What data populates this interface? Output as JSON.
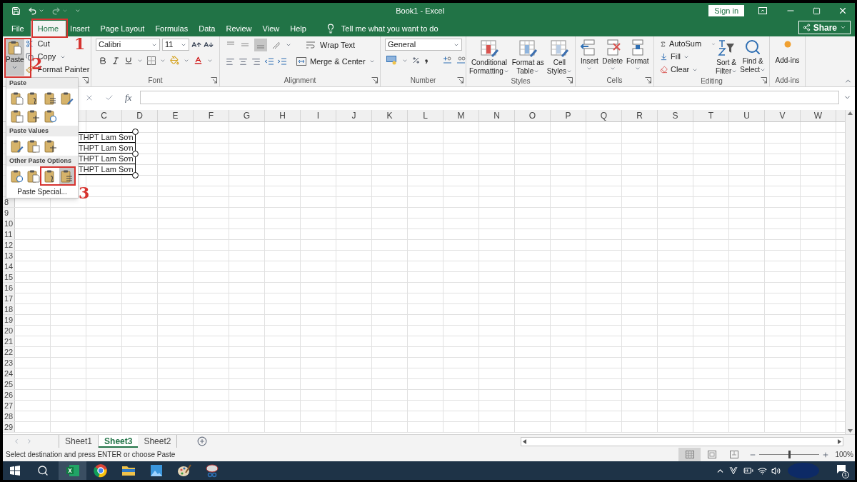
{
  "title": "Book1  -  Excel",
  "sign_in": "Sign in",
  "share": "Share",
  "tabs": [
    {
      "label": "File",
      "selected": false
    },
    {
      "label": "Home",
      "selected": true
    },
    {
      "label": "Insert",
      "selected": false
    },
    {
      "label": "Page Layout",
      "selected": false
    },
    {
      "label": "Formulas",
      "selected": false
    },
    {
      "label": "Data",
      "selected": false
    },
    {
      "label": "Review",
      "selected": false
    },
    {
      "label": "View",
      "selected": false
    },
    {
      "label": "Help",
      "selected": false
    }
  ],
  "tell_me": "Tell me what you want to do",
  "clipboard": {
    "paste": "Paste",
    "cut": "Cut",
    "copy": "Copy",
    "format_painter": "Format Painter"
  },
  "font": {
    "name": "Calibri",
    "size": "11",
    "label": "Font"
  },
  "alignment": {
    "wrap_text": "Wrap Text",
    "merge": "Merge & Center",
    "label": "Alignment"
  },
  "number": {
    "format": "General",
    "label": "Number"
  },
  "styles": {
    "buttons": [
      {
        "lines": [
          "Conditional",
          "Formatting"
        ]
      },
      {
        "lines": [
          "Format as",
          "Table"
        ]
      },
      {
        "lines": [
          "Cell",
          "Styles"
        ]
      }
    ],
    "label": "Styles"
  },
  "cells": {
    "buttons": [
      "Insert",
      "Delete",
      "Format"
    ],
    "label": "Cells"
  },
  "editing": {
    "autosum": "AutoSum",
    "fill": "Fill",
    "clear": "Clear",
    "buttons": [
      {
        "lines": [
          "Sort &",
          "Filter"
        ]
      },
      {
        "lines": [
          "Find &",
          "Select"
        ]
      }
    ],
    "label": "Editing"
  },
  "addins": {
    "button": "Add-ins",
    "label": "Add-ins"
  },
  "formula_bar": {
    "fx": "fx"
  },
  "columns": [
    "C",
    "D",
    "E",
    "F",
    "G",
    "H",
    "I",
    "J",
    "K",
    "L",
    "M",
    "N",
    "O",
    "P",
    "Q",
    "R",
    "S",
    "T",
    "U",
    "V",
    "W"
  ],
  "rows": [
    "8",
    "9",
    "10",
    "11",
    "12",
    "13",
    "14",
    "15",
    "16",
    "17",
    "18",
    "19",
    "20",
    "21",
    "22",
    "23",
    "24",
    "25",
    "26",
    "27",
    "28",
    "29"
  ],
  "linked_picture": {
    "lines": [
      "THPT Lam Sơn",
      "THPT Lam Sơn",
      "THPT Lam Sơn",
      "THPT Lam Sơn"
    ]
  },
  "paste_menu": {
    "sections": [
      {
        "title": "Paste",
        "items": [
          {
            "selected": false
          },
          {
            "selected": false
          },
          {
            "selected": false
          },
          {
            "selected": false
          },
          {
            "selected": false
          },
          {
            "selected": false
          },
          {
            "selected": false
          }
        ]
      },
      {
        "title": "Paste Values",
        "items": [
          {
            "selected": false
          },
          {
            "selected": false
          },
          {
            "selected": false
          }
        ]
      },
      {
        "title": "Other Paste Options",
        "items": [
          {
            "selected": false
          },
          {
            "selected": false
          },
          {
            "selected": false
          },
          {
            "selected": true
          }
        ]
      }
    ],
    "paste_special": "Paste Special..."
  },
  "sheets": [
    {
      "label": "Sheet1",
      "selected": false
    },
    {
      "label": "Sheet3",
      "selected": true
    },
    {
      "label": "Sheet2",
      "selected": false
    }
  ],
  "status": "Select destination and press ENTER or choose Paste",
  "view_buttons": [
    {
      "selected": true
    },
    {
      "selected": false
    },
    {
      "selected": false
    }
  ],
  "zoom": {
    "level": 0.48,
    "reading": "100%"
  },
  "taskbar": {
    "apps": [
      {
        "selected": true
      },
      {
        "selected": false
      },
      {
        "selected": false
      },
      {
        "selected": false
      },
      {
        "selected": false
      },
      {
        "selected": false
      }
    ],
    "notifications": "1"
  },
  "annotations": [
    {
      "label": "1"
    },
    {
      "label": "2"
    },
    {
      "label": "3"
    }
  ]
}
